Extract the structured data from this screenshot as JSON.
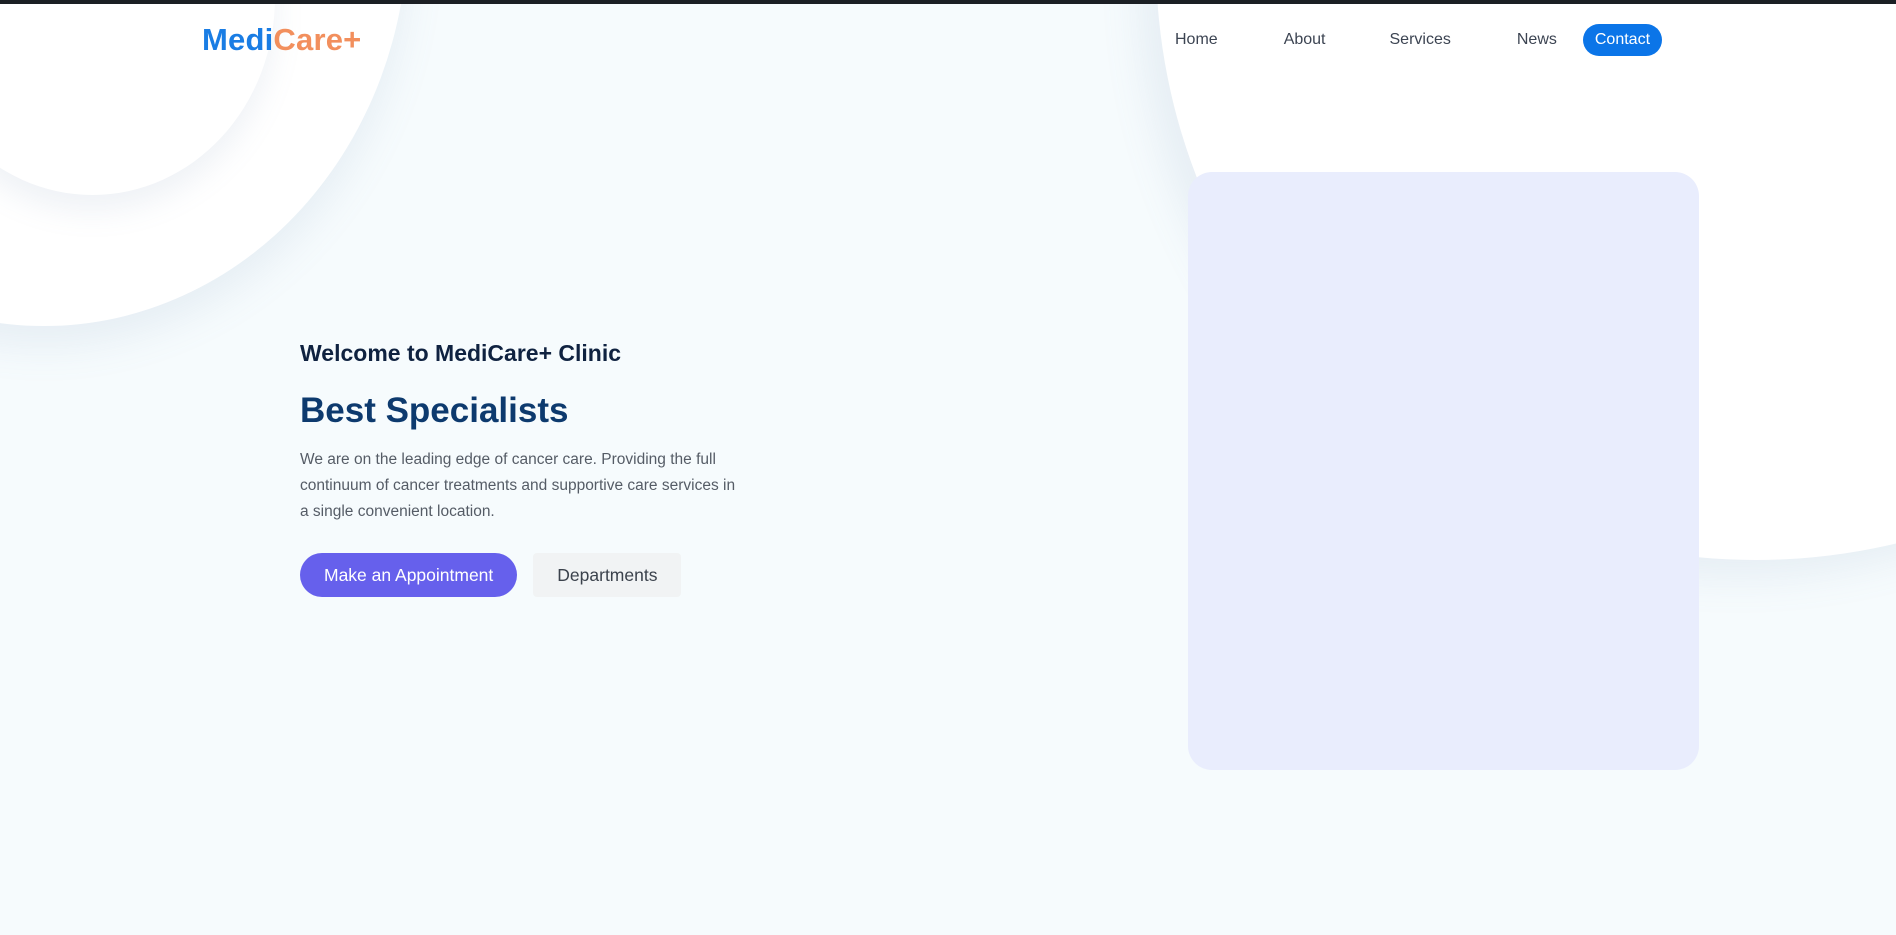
{
  "header": {
    "logo": {
      "part1": "Medi",
      "part2": "Care+"
    },
    "nav": {
      "items": [
        {
          "label": "Home"
        },
        {
          "label": "About"
        },
        {
          "label": "Services"
        },
        {
          "label": "News"
        }
      ],
      "contact_label": "Contact"
    }
  },
  "hero": {
    "welcome": "Welcome to MediCare+ Clinic",
    "title": "Best Specialists",
    "description": "We are on the leading edge of cancer care. Providing the full continuum of cancer treatments and supportive care services in a single convenient location.",
    "primary_button": "Make an Appointment",
    "secondary_button": "Departments"
  },
  "colors": {
    "logo_primary": "#1a7de4",
    "logo_accent": "#f28f5d",
    "contact_button": "#0b75e8",
    "appointment_button": "#6660ec",
    "title": "#0d3a6e",
    "image_placeholder": "#e9edfd"
  }
}
